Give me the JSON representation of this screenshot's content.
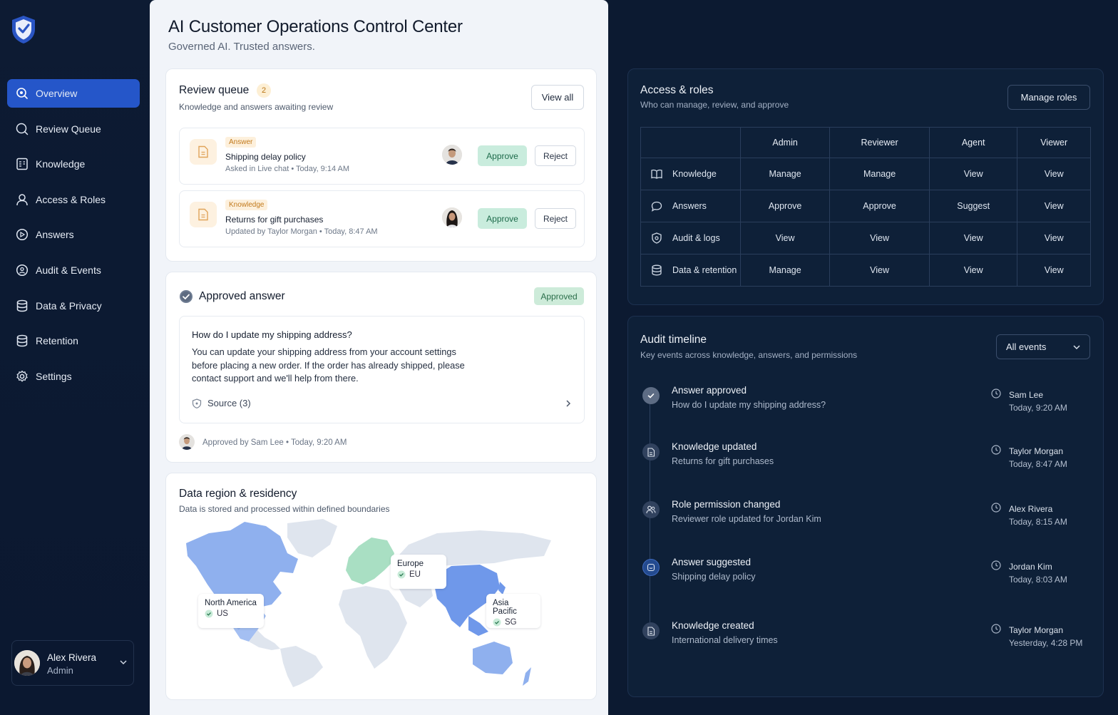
{
  "sidebar": {
    "items": [
      {
        "label": "Overview",
        "icon": "overview-icon"
      },
      {
        "label": "Review Queue",
        "icon": "search-icon"
      },
      {
        "label": "Knowledge",
        "icon": "knowledge-icon"
      },
      {
        "label": "Access & Roles",
        "icon": "user-icon"
      },
      {
        "label": "Answers",
        "icon": "answers-icon"
      },
      {
        "label": "Audit & Events",
        "icon": "audit-icon"
      },
      {
        "label": "Data & Privacy",
        "icon": "database-icon"
      },
      {
        "label": "Retention",
        "icon": "retention-icon"
      },
      {
        "label": "Settings",
        "icon": "gear-icon"
      }
    ],
    "user": {
      "name": "Alex Rivera",
      "role": "Admin"
    }
  },
  "header": {
    "title": "AI Customer Operations Control Center",
    "subtitle": "Governed AI. Trusted answers."
  },
  "review_queue": {
    "title": "Review queue",
    "count": "2",
    "subtitle": "Knowledge and answers awaiting review",
    "view_all": "View all",
    "items": [
      {
        "tag": "Answer",
        "title": "Shipping delay policy",
        "meta": "Asked in Live chat  •  Today, 9:14 AM",
        "approve": "Approve",
        "reject": "Reject"
      },
      {
        "tag": "Knowledge",
        "title": "Returns for gift purchases",
        "meta": "Updated by Taylor Morgan  •  Today, 8:47 AM",
        "approve": "Approve",
        "reject": "Reject"
      }
    ]
  },
  "approved": {
    "title": "Approved answer",
    "badge": "Approved",
    "question": "How do I update my shipping address?",
    "answer": "You can update your shipping address from your account settings before placing a new order. If the order has already shipped, please contact support and we'll help from there.",
    "source": "Source (3)",
    "footer": "Approved by Sam Lee  •  Today, 9:20 AM"
  },
  "region": {
    "title": "Data region & residency",
    "subtitle": "Data is stored and processed within defined boundaries",
    "labels": [
      {
        "name": "North America",
        "code": "US"
      },
      {
        "name": "Europe",
        "code": "EU"
      },
      {
        "name": "Asia Pacific",
        "code": "SG"
      }
    ],
    "colors": {
      "north_america": "#8fb0ee",
      "europe": "#a9dfc3",
      "asia": "#6f98ea",
      "other": "#dde3ec"
    }
  },
  "access": {
    "title": "Access & roles",
    "subtitle": "Who can manage, review, and approve",
    "manage_button": "Manage roles",
    "columns": [
      "Admin",
      "Reviewer",
      "Agent",
      "Viewer"
    ],
    "rows": [
      {
        "resource": "Knowledge",
        "icon": "book-icon",
        "values": [
          "Manage",
          "Manage",
          "View",
          "View"
        ]
      },
      {
        "resource": "Answers",
        "icon": "chat-icon",
        "values": [
          "Approve",
          "Approve",
          "Suggest",
          "View"
        ]
      },
      {
        "resource": "Audit & logs",
        "icon": "shield-icon",
        "values": [
          "View",
          "View",
          "View",
          "View"
        ]
      },
      {
        "resource": "Data & retention",
        "icon": "database-icon",
        "values": [
          "Manage",
          "View",
          "View",
          "View"
        ]
      }
    ]
  },
  "audit": {
    "title": "Audit timeline",
    "subtitle": "Key events across knowledge, answers, and permissions",
    "filter": "All events",
    "events": [
      {
        "title": "Answer approved",
        "detail": "How do I update my shipping address?",
        "who": "Sam Lee",
        "when": "Today, 9:20 AM",
        "icon": "check-icon"
      },
      {
        "title": "Knowledge updated",
        "detail": "Returns for gift purchases",
        "who": "Taylor Morgan",
        "when": "Today, 8:47 AM",
        "icon": "document-icon"
      },
      {
        "title": "Role permission changed",
        "detail": "Reviewer role updated for Jordan Kim",
        "who": "Alex Rivera",
        "when": "Today, 8:15 AM",
        "icon": "users-icon"
      },
      {
        "title": "Answer suggested",
        "detail": "Shipping delay policy",
        "who": "Jordan Kim",
        "when": "Today, 8:03 AM",
        "icon": "suggest-icon"
      },
      {
        "title": "Knowledge created",
        "detail": "International delivery times",
        "who": "Taylor Morgan",
        "when": "Yesterday, 4:28 PM",
        "icon": "document-icon"
      }
    ]
  }
}
